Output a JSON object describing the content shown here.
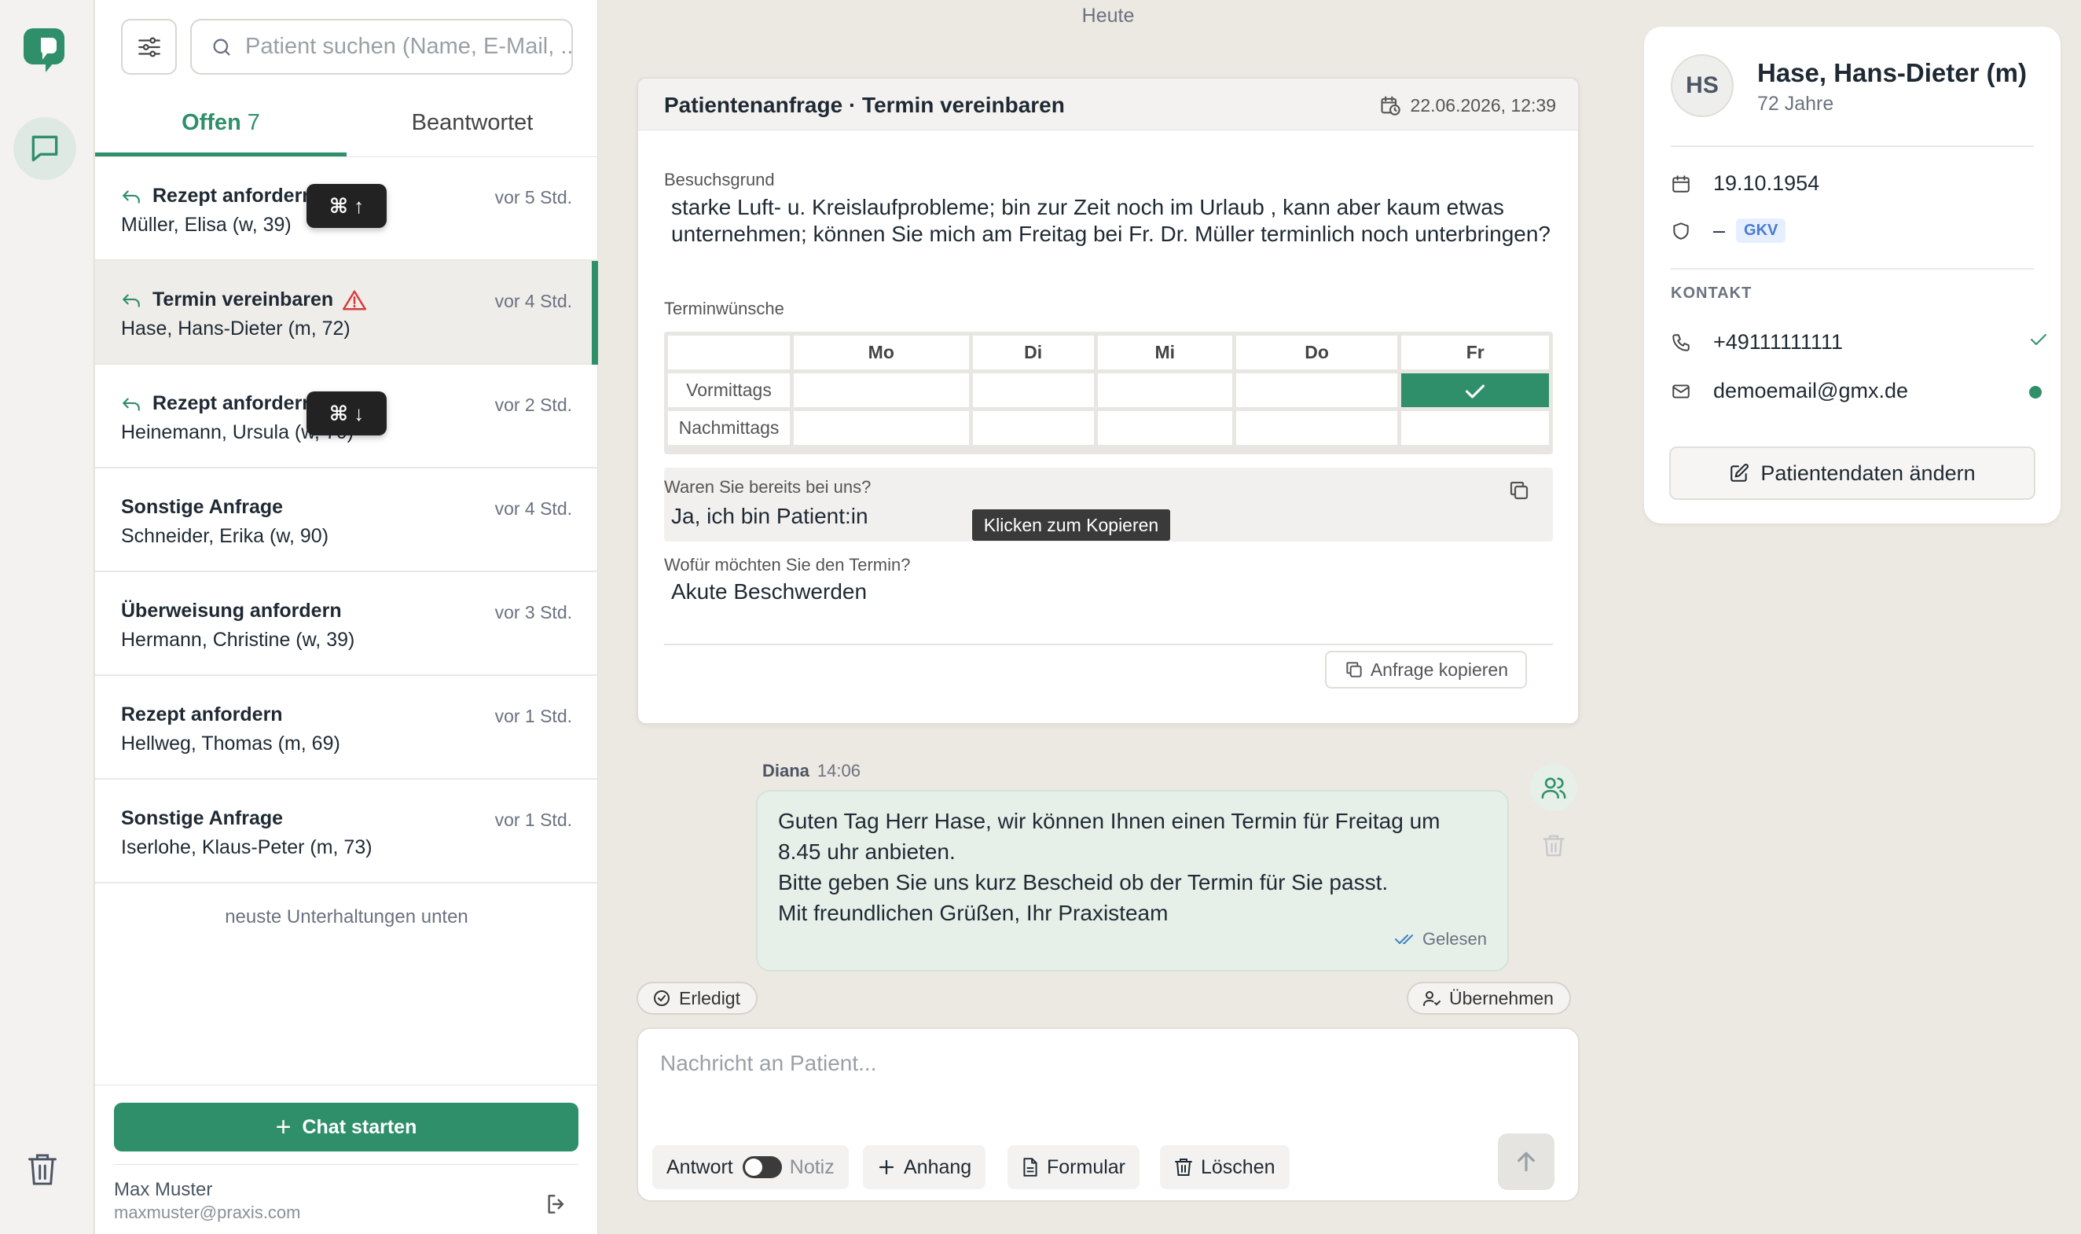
{
  "rail": {
    "logo_icon": "chat-logo-icon",
    "chat_icon": "message-square-icon",
    "trash_icon": "trash-icon"
  },
  "list": {
    "search_placeholder": "Patient suchen (Name, E-Mail, ...)",
    "tabs": {
      "open_label": "Offen",
      "open_count": "7",
      "answered_label": "Beantwortet"
    },
    "items": [
      {
        "title": "Rezept anfordern",
        "name": "Müller, Elisa (w, 39)",
        "time": "vor 5 Std.",
        "reply": true
      },
      {
        "title": "Termin vereinbaren",
        "name": "Hase, Hans-Dieter (m, 72)",
        "time": "vor 4 Std.",
        "reply": true,
        "warning": true
      },
      {
        "title": "Rezept anfordern",
        "name": "Heinemann, Ursula (w, 70)",
        "time": "vor 2 Std.",
        "reply": true
      },
      {
        "title": "Sonstige Anfrage",
        "name": "Schneider, Erika (w, 90)",
        "time": "vor 4 Std."
      },
      {
        "title": "Überweisung anfordern",
        "name": "Hermann, Christine (w, 39)",
        "time": "vor 3 Std."
      },
      {
        "title": "Rezept anfordern",
        "name": "Hellweg, Thomas (m, 69)",
        "time": "vor 1 Std."
      },
      {
        "title": "Sonstige Anfrage",
        "name": "Iserlohe, Klaus-Peter (m, 73)",
        "time": "vor 1 Std."
      }
    ],
    "kbd_up": "⌘ ↑",
    "kbd_down": "⌘ ↓",
    "newest_hint": "neuste Unterhaltungen unten",
    "chat_start": "Chat starten",
    "user_name": "Max Muster",
    "user_email": "maxmuster@praxis.com"
  },
  "main": {
    "today": "Heute",
    "request": {
      "title": "Patientenanfrage · Termin vereinbaren",
      "date": "22.06.2026, 12:39",
      "reason_label": "Besuchsgrund",
      "reason_text": "starke Luft- u. Kreislaufprobleme; bin zur Zeit noch im Urlaub , kann aber kaum etwas unternehmen; können Sie mich am Freitag bei Fr. Dr. Müller terminlich noch unterbringen?",
      "wishes_label": "Terminwünsche",
      "days": [
        "Mo",
        "Di",
        "Mi",
        "Do",
        "Fr"
      ],
      "rows": [
        {
          "label": "Vormittags",
          "selected": [
            false,
            false,
            false,
            false,
            true
          ]
        },
        {
          "label": "Nachmittags",
          "selected": [
            false,
            false,
            false,
            false,
            false
          ]
        }
      ],
      "visited_label": "Waren Sie bereits bei uns?",
      "visited_value": "Ja, ich bin Patient:in",
      "tooltip": "Klicken zum Kopieren",
      "purpose_label": "Wofür möchten Sie den Termin?",
      "purpose_value": "Akute Beschwerden",
      "copy_request": "Anfrage kopieren"
    },
    "message": {
      "author": "Diana",
      "time": "14:06",
      "lines": [
        "Guten Tag Herr Hase, wir können Ihnen einen Termin für Freitag um 8.45 uhr anbieten.",
        "Bitte geben Sie uns kurz Bescheid ob der Termin für Sie passt.",
        "Mit freundlichen Grüßen, Ihr Praxisteam"
      ],
      "status": "Gelesen"
    },
    "done_label": "Erledigt",
    "take_over_label": "Übernehmen",
    "composer": {
      "placeholder": "Nachricht an Patient...",
      "answer_label": "Antwort",
      "note_label": "Notiz",
      "attach_label": "Anhang",
      "form_label": "Formular",
      "delete_label": "Löschen"
    }
  },
  "patient": {
    "initials": "HS",
    "name": "Hase, Hans-Dieter (m)",
    "age": "72 Jahre",
    "birthdate": "19.10.1954",
    "insurance_dash": "–",
    "insurance_type": "GKV",
    "contact_heading": "KONTAKT",
    "phone": "+49111111111",
    "email": "demoemail@gmx.de",
    "edit_label": "Patientendaten ändern"
  },
  "colors": {
    "accent": "#2f8f6b",
    "background": "#ece8e2",
    "bubble": "#e6f0e9",
    "warning": "#d93b3b"
  }
}
